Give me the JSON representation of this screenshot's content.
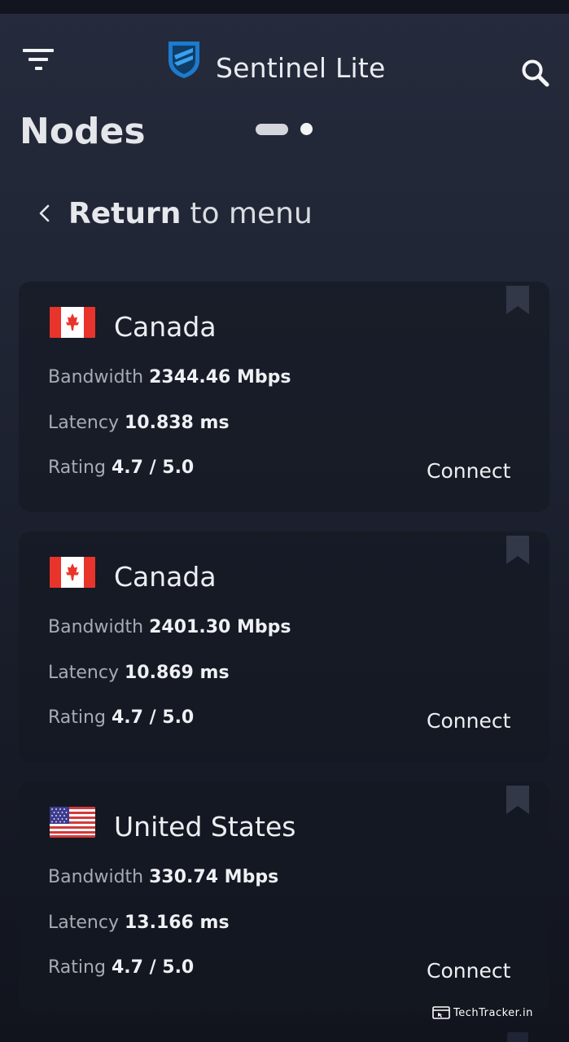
{
  "app": {
    "title": "Sentinel Lite"
  },
  "page": {
    "title": "Nodes"
  },
  "back": {
    "strong": "Return",
    "rest": "to menu"
  },
  "pager": {
    "pages": 2,
    "active": 1
  },
  "nodes": [
    {
      "country": "Canada",
      "flag": "canada-flag",
      "bandwidth_label": "Bandwidth",
      "bandwidth": "2344.46 Mbps",
      "latency_label": "Latency",
      "latency": "10.838 ms",
      "rating_label": "Rating",
      "rating": "4.7 / 5.0",
      "action": "Connect"
    },
    {
      "country": "Canada",
      "flag": "canada-flag",
      "bandwidth_label": "Bandwidth",
      "bandwidth": "2401.30 Mbps",
      "latency_label": "Latency",
      "latency": "10.869 ms",
      "rating_label": "Rating",
      "rating": "4.7 / 5.0",
      "action": "Connect"
    },
    {
      "country": "United States",
      "flag": "us-flag",
      "bandwidth_label": "Bandwidth",
      "bandwidth": "330.74 Mbps",
      "latency_label": "Latency",
      "latency": "13.166 ms",
      "rating_label": "Rating",
      "rating": "4.7 / 5.0",
      "action": "Connect"
    }
  ],
  "watermark": {
    "text": "TechTracker.in"
  },
  "colors": {
    "background": "#1f2433",
    "card": "#161a25",
    "accent": "#1e7fd0",
    "text": "#eef0f3",
    "muted": "#a7abb3"
  },
  "icons": {
    "menu": "filter-menu-icon",
    "logo": "shield-logo-icon",
    "search": "search-icon",
    "back": "chevron-left-icon",
    "bookmark": "bookmark-icon"
  }
}
